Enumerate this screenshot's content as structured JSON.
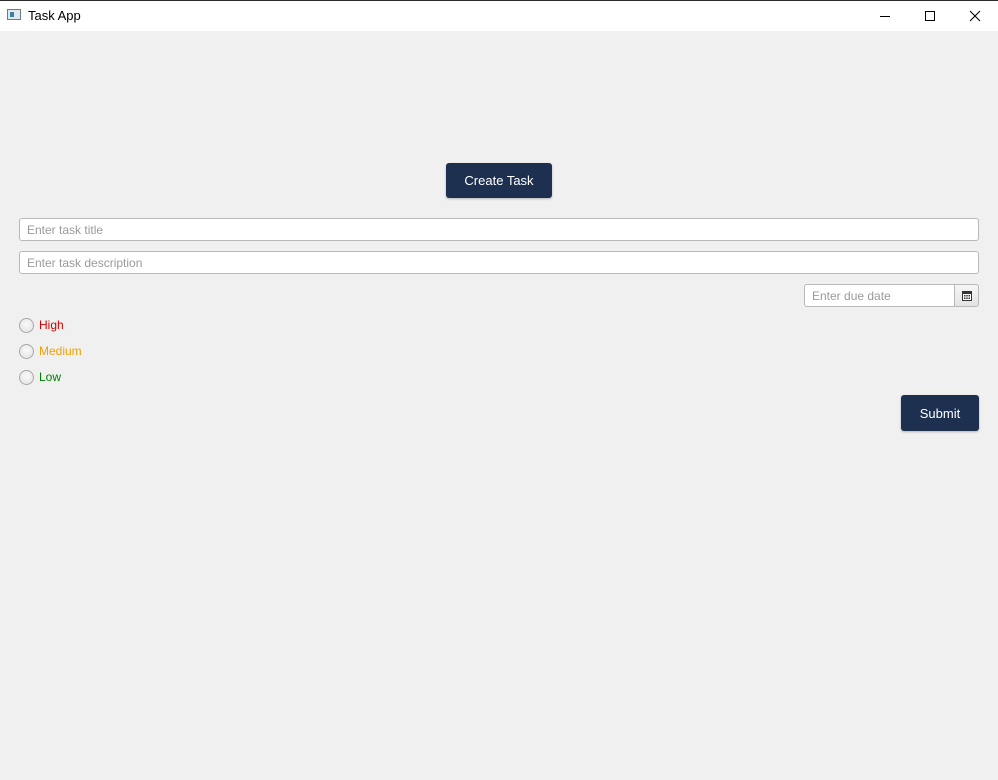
{
  "window": {
    "title": "Task App",
    "icon": "window-app-icon",
    "controls": [
      "minimize-icon",
      "maximize-icon",
      "close-icon"
    ]
  },
  "main": {
    "create_task_label": "Create Task",
    "task_title_placeholder": "Enter task title",
    "task_description_placeholder": "Enter task description",
    "due_date_placeholder": "Enter due date",
    "calendar_icon": "calendar-icon",
    "priorities": [
      {
        "label": "High",
        "color": "#d40000",
        "selected": false
      },
      {
        "label": "Medium",
        "color": "#f0a000",
        "selected": false
      },
      {
        "label": "Low",
        "color": "#008000",
        "selected": false
      }
    ],
    "submit_label": "Submit"
  },
  "colors": {
    "button_background": "#1e3050",
    "button_text": "#ffffff",
    "window_background": "#f0f0f0"
  }
}
